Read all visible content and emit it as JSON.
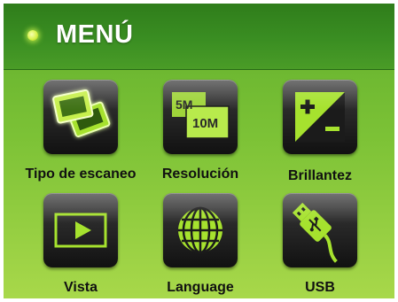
{
  "header": {
    "title": "MENÚ"
  },
  "menu": {
    "items": [
      {
        "label": "Tipo de escaneo",
        "icon": "photos-icon"
      },
      {
        "label": "Resolución",
        "icon": "resolution-icon",
        "badge_top": "5M",
        "badge_bottom": "10M"
      },
      {
        "label": "Brillantez",
        "icon": "brightness-icon"
      },
      {
        "label": "Vista",
        "icon": "play-icon"
      },
      {
        "label": "Language",
        "icon": "globe-icon"
      },
      {
        "label": "USB",
        "icon": "usb-icon"
      }
    ]
  },
  "colors": {
    "accent": "#d6f24a",
    "icon_green": "#a6e22e",
    "header_bg": "#3a8e22"
  }
}
